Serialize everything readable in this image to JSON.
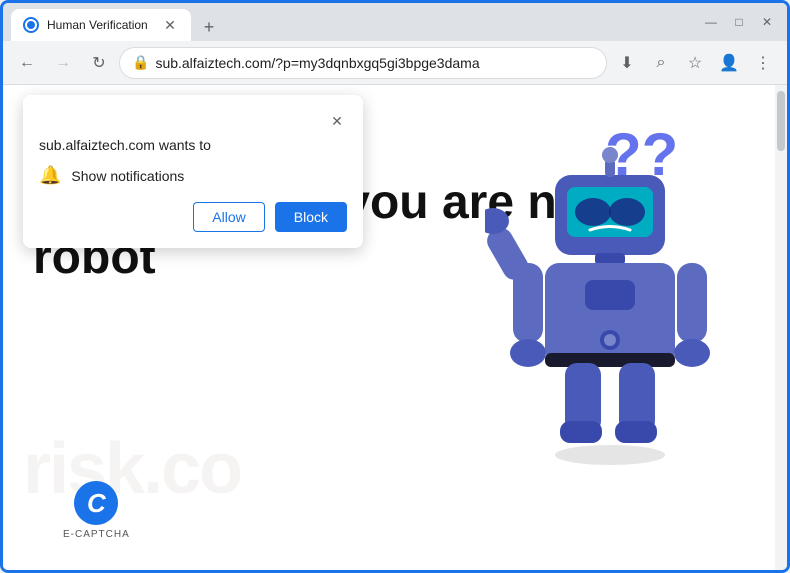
{
  "browser": {
    "tab": {
      "title": "Human Verification",
      "favicon_alt": "site-favicon"
    },
    "new_tab_icon": "+",
    "window_controls": {
      "minimize": "—",
      "maximize": "□",
      "close": "✕"
    },
    "toolbar": {
      "back_arrow": "←",
      "forward_arrow": "→",
      "reload": "↻",
      "address": "sub.alfaiztech.com/?p=my3dqnbxgq5gi3bpge3dama",
      "lock_icon": "🔒",
      "search_icon": "⌕",
      "bookmark_icon": "☆",
      "profile_icon": "👤",
      "more_icon": "⋮",
      "download_icon": "⬇"
    }
  },
  "page": {
    "main_text": "Click Allow if you are not a robot",
    "watermark": "risk.co",
    "ecaptcha_label": "E-CAPTCHA"
  },
  "popup": {
    "site_name": "sub.alfaiztech.com wants to",
    "notification_label": "Show notifications",
    "allow_button": "Allow",
    "block_button": "Block",
    "close_icon": "✕"
  },
  "question_marks": "??",
  "colors": {
    "accent": "#1a73e8",
    "robot_body": "#5c6bc0",
    "robot_head": "#3949ab",
    "robot_visor": "#00bcd4"
  }
}
